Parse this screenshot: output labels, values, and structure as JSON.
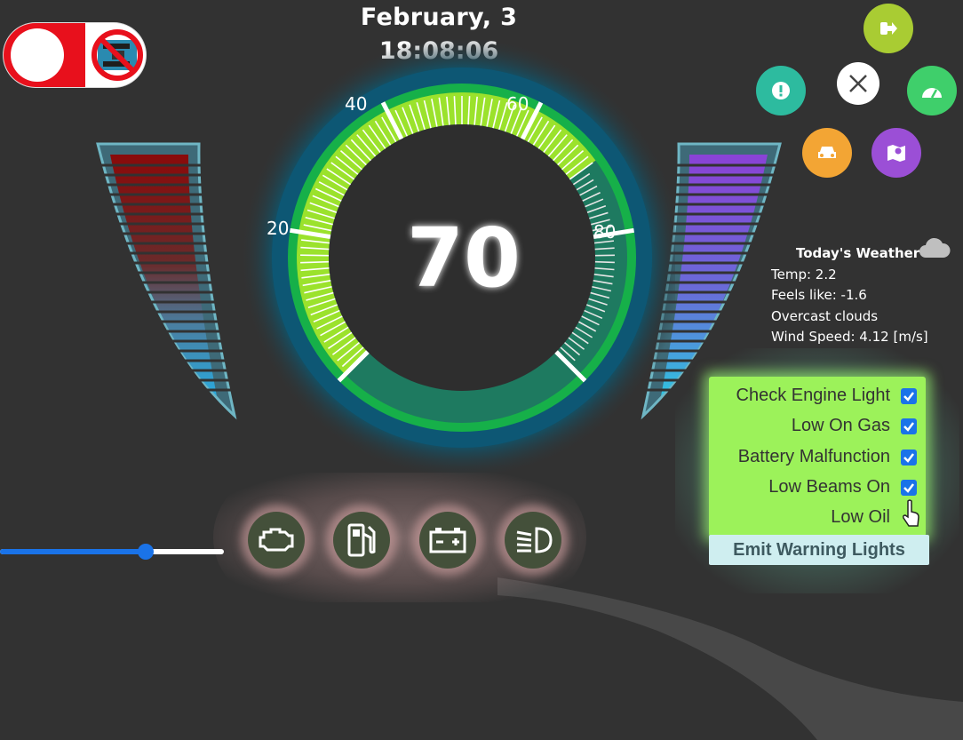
{
  "header": {
    "date": "February, 3",
    "time": "18:08:06"
  },
  "arduino_toggle": {
    "state": "off"
  },
  "speedometer": {
    "speed": "70",
    "tick_labels": [
      "20",
      "40",
      "60",
      "80"
    ],
    "colors": {
      "green": "#9be22c",
      "ring": "#11c13b",
      "outer": "#0e5a7a",
      "inner": "#2e2e2e"
    }
  },
  "radial_menu": {
    "items": [
      {
        "name": "exit",
        "color": "#a9cc33"
      },
      {
        "name": "warning",
        "color": "#2dbb9f"
      },
      {
        "name": "close",
        "color": "#ffffff"
      },
      {
        "name": "speedometer",
        "color": "#3fcf6b"
      },
      {
        "name": "car",
        "color": "#f3a534"
      },
      {
        "name": "map",
        "color": "#9b4fd6"
      }
    ]
  },
  "weather": {
    "title": "Today's Weather",
    "temp": "Temp: 2.2",
    "feels_like": "Feels like: -1.6",
    "description": "Overcast clouds",
    "wind": "Wind Speed: 4.12 [m/s]"
  },
  "warnings": {
    "items": [
      {
        "label": "Check Engine Light",
        "checked": true
      },
      {
        "label": "Low On Gas",
        "checked": true
      },
      {
        "label": "Battery Malfunction",
        "checked": true
      },
      {
        "label": "Low Beams On",
        "checked": true
      },
      {
        "label": "Low Oil",
        "checked": false
      }
    ],
    "emit_label": "Emit Warning Lights"
  },
  "warning_icons": [
    "engine-icon",
    "fuel-icon",
    "battery-icon",
    "headlight-icon"
  ],
  "slider": {
    "value_fraction": 0.65
  }
}
